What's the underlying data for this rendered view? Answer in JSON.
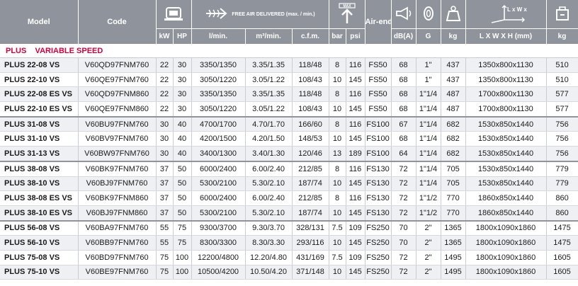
{
  "header": {
    "model": "Model",
    "code": "Code",
    "fad_title": "FREE AIR DELIVERED (max. / min.)",
    "max_label": "MAX",
    "air_end": "Air-end",
    "dims_label": "L x W x H",
    "units": [
      "kW",
      "HP",
      "l/min.",
      "m³/min.",
      "c.f.m.",
      "bar",
      "psi",
      "dB(A)",
      "G",
      "kg",
      "L X W X H (mm)",
      "kg"
    ]
  },
  "section": {
    "title": "PLUS    VARIABLE SPEED"
  },
  "rows": [
    {
      "model": "PLUS 22-08 VS",
      "code": "V60QD97FNM760",
      "kw": "22",
      "hp": "30",
      "lmin": "3350/1350",
      "m3": "3.35/1.35",
      "cfm": "118/48",
      "bar": "8",
      "psi": "116",
      "airend": "FS50",
      "dba": "68",
      "g": "1\"",
      "kg": "437",
      "dims": "1350x800x1130",
      "wt": "510"
    },
    {
      "model": "PLUS 22-10 VS",
      "code": "V60QE97FNM760",
      "kw": "22",
      "hp": "30",
      "lmin": "3050/1220",
      "m3": "3.05/1.22",
      "cfm": "108/43",
      "bar": "10",
      "psi": "145",
      "airend": "FS50",
      "dba": "68",
      "g": "1\"",
      "kg": "437",
      "dims": "1350x800x1130",
      "wt": "510"
    },
    {
      "model": "PLUS 22-08 ES VS",
      "code": "V60QD97FNM860",
      "kw": "22",
      "hp": "30",
      "lmin": "3350/1350",
      "m3": "3.35/1.35",
      "cfm": "118/48",
      "bar": "8",
      "psi": "116",
      "airend": "FS50",
      "dba": "68",
      "g": "1\"1/4",
      "kg": "487",
      "dims": "1700x800x1130",
      "wt": "577"
    },
    {
      "model": "PLUS 22-10 ES VS",
      "code": "V60QE97FNM860",
      "kw": "22",
      "hp": "30",
      "lmin": "3050/1220",
      "m3": "3.05/1.22",
      "cfm": "108/43",
      "bar": "10",
      "psi": "145",
      "airend": "FS50",
      "dba": "68",
      "g": "1\"1/4",
      "kg": "487",
      "dims": "1700x800x1130",
      "wt": "577"
    },
    {
      "model": "PLUS 31-08 VS",
      "code": "V60BU97FNM760",
      "kw": "30",
      "hp": "40",
      "lmin": "4700/1700",
      "m3": "4.70/1.70",
      "cfm": "166/60",
      "bar": "8",
      "psi": "116",
      "airend": "FS100",
      "dba": "67",
      "g": "1\"1/4",
      "kg": "682",
      "dims": "1530x850x1440",
      "wt": "756"
    },
    {
      "model": "PLUS 31-10 VS",
      "code": "V60BV97FNM760",
      "kw": "30",
      "hp": "40",
      "lmin": "4200/1500",
      "m3": "4.20/1.50",
      "cfm": "148/53",
      "bar": "10",
      "psi": "145",
      "airend": "FS100",
      "dba": "68",
      "g": "1\"1/4",
      "kg": "682",
      "dims": "1530x850x1440",
      "wt": "756"
    },
    {
      "model": "PLUS 31-13 VS",
      "code": "V60BW97FNM760",
      "kw": "30",
      "hp": "40",
      "lmin": "3400/1300",
      "m3": "3.40/1.30",
      "cfm": "120/46",
      "bar": "13",
      "psi": "189",
      "airend": "FS100",
      "dba": "64",
      "g": "1\"1/4",
      "kg": "682",
      "dims": "1530x850x1440",
      "wt": "756"
    },
    {
      "model": "PLUS 38-08 VS",
      "code": "V60BK97FNM760",
      "kw": "37",
      "hp": "50",
      "lmin": "6000/2400",
      "m3": "6.00/2.40",
      "cfm": "212/85",
      "bar": "8",
      "psi": "116",
      "airend": "FS130",
      "dba": "72",
      "g": "1\"1/4",
      "kg": "705",
      "dims": "1530x850x1440",
      "wt": "779"
    },
    {
      "model": "PLUS 38-10 VS",
      "code": "V60BJ97FNM760",
      "kw": "37",
      "hp": "50",
      "lmin": "5300/2100",
      "m3": "5.30/2.10",
      "cfm": "187/74",
      "bar": "10",
      "psi": "145",
      "airend": "FS130",
      "dba": "72",
      "g": "1\"1/4",
      "kg": "705",
      "dims": "1530x850x1440",
      "wt": "779"
    },
    {
      "model": "PLUS 38-08 ES VS",
      "code": "V60BK97FNM860",
      "kw": "37",
      "hp": "50",
      "lmin": "6000/2400",
      "m3": "6.00/2.40",
      "cfm": "212/85",
      "bar": "8",
      "psi": "116",
      "airend": "FS130",
      "dba": "72",
      "g": "1\"1/2",
      "kg": "770",
      "dims": "1860x850x1440",
      "wt": "860"
    },
    {
      "model": "PLUS 38-10 ES VS",
      "code": "V60BJ97FNM860",
      "kw": "37",
      "hp": "50",
      "lmin": "5300/2100",
      "m3": "5.30/2.10",
      "cfm": "187/74",
      "bar": "10",
      "psi": "145",
      "airend": "FS130",
      "dba": "72",
      "g": "1\"1/2",
      "kg": "770",
      "dims": "1860x850x1440",
      "wt": "860"
    },
    {
      "model": "PLUS 56-08 VS",
      "code": "V60BA97FNM760",
      "kw": "55",
      "hp": "75",
      "lmin": "9300/3700",
      "m3": "9.30/3.70",
      "cfm": "328/131",
      "bar": "7.5",
      "psi": "109",
      "airend": "FS250",
      "dba": "70",
      "g": "2\"",
      "kg": "1365",
      "dims": "1800x1090x1860",
      "wt": "1475"
    },
    {
      "model": "PLUS 56-10 VS",
      "code": "V60BB97FNM760",
      "kw": "55",
      "hp": "75",
      "lmin": "8300/3300",
      "m3": "8.30/3.30",
      "cfm": "293/116",
      "bar": "10",
      "psi": "145",
      "airend": "FS250",
      "dba": "70",
      "g": "2\"",
      "kg": "1365",
      "dims": "1800x1090x1860",
      "wt": "1475"
    },
    {
      "model": "PLUS 75-08 VS",
      "code": "V60BD97FNM760",
      "kw": "75",
      "hp": "100",
      "lmin": "12200/4800",
      "m3": "12.20/4.80",
      "cfm": "431/169",
      "bar": "7.5",
      "psi": "109",
      "airend": "FS250",
      "dba": "72",
      "g": "2\"",
      "kg": "1495",
      "dims": "1800x1090x1860",
      "wt": "1605"
    },
    {
      "model": "PLUS 75-10 VS",
      "code": "V60BE97FNM760",
      "kw": "75",
      "hp": "100",
      "lmin": "10500/4200",
      "m3": "10.50/4.20",
      "cfm": "371/148",
      "bar": "10",
      "psi": "145",
      "airend": "FS250",
      "dba": "72",
      "g": "2\"",
      "kg": "1495",
      "dims": "1800x1090x1860",
      "wt": "1605"
    }
  ],
  "group_starts": [
    0,
    4,
    7,
    11
  ],
  "icons": [
    "motor-icon",
    "air-delivery-icon",
    "pressure-gauge-icon",
    "horn-icon",
    "pipe-connection-icon",
    "weight-icon",
    "dimensions-axes-icon",
    "package-weight-icon"
  ],
  "colors": {
    "header_bg": "#8f949c",
    "section_text": "#d0003a",
    "odd_row_bg": "#eef0f3",
    "border": "#c9ccd1"
  }
}
